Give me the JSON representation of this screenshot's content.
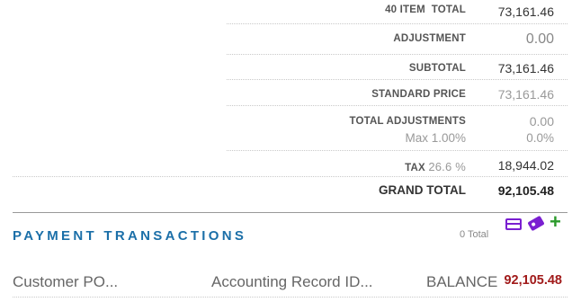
{
  "totals": {
    "item_total": {
      "label": "40 ITEM  TOTAL",
      "value": "73,161.46"
    },
    "adjustment": {
      "label": "ADJUSTMENT",
      "value": "0.00"
    },
    "subtotal": {
      "label": "SUBTOTAL",
      "value": "73,161.46"
    },
    "standard_price": {
      "label": "STANDARD PRICE",
      "value": "73,161.46"
    },
    "total_adjustments": {
      "label": "TOTAL ADJUSTMENTS",
      "value": "0.00",
      "max_label": "Max 1.00%",
      "max_value": "0.0%"
    },
    "tax": {
      "label": "TAX",
      "rate": "26.6 %",
      "value": "18,944.02"
    },
    "grand_total": {
      "label": "GRAND TOTAL",
      "value": "92,105.48"
    }
  },
  "payment_transactions": {
    "title": "PAYMENT TRANSACTIONS",
    "count_text": "0 Total",
    "icons": [
      "credit-card-icon",
      "tag-icon",
      "add-icon"
    ],
    "columns": [
      "Customer PO...",
      "Accounting Record ID...",
      "BALANCE"
    ],
    "balance_value": "92,105.48"
  },
  "colors": {
    "accent": "#1b6fa8",
    "balance": "#a11b1b",
    "icon_purple": "#7a1fd1",
    "add_green": "#2b9a2b"
  }
}
